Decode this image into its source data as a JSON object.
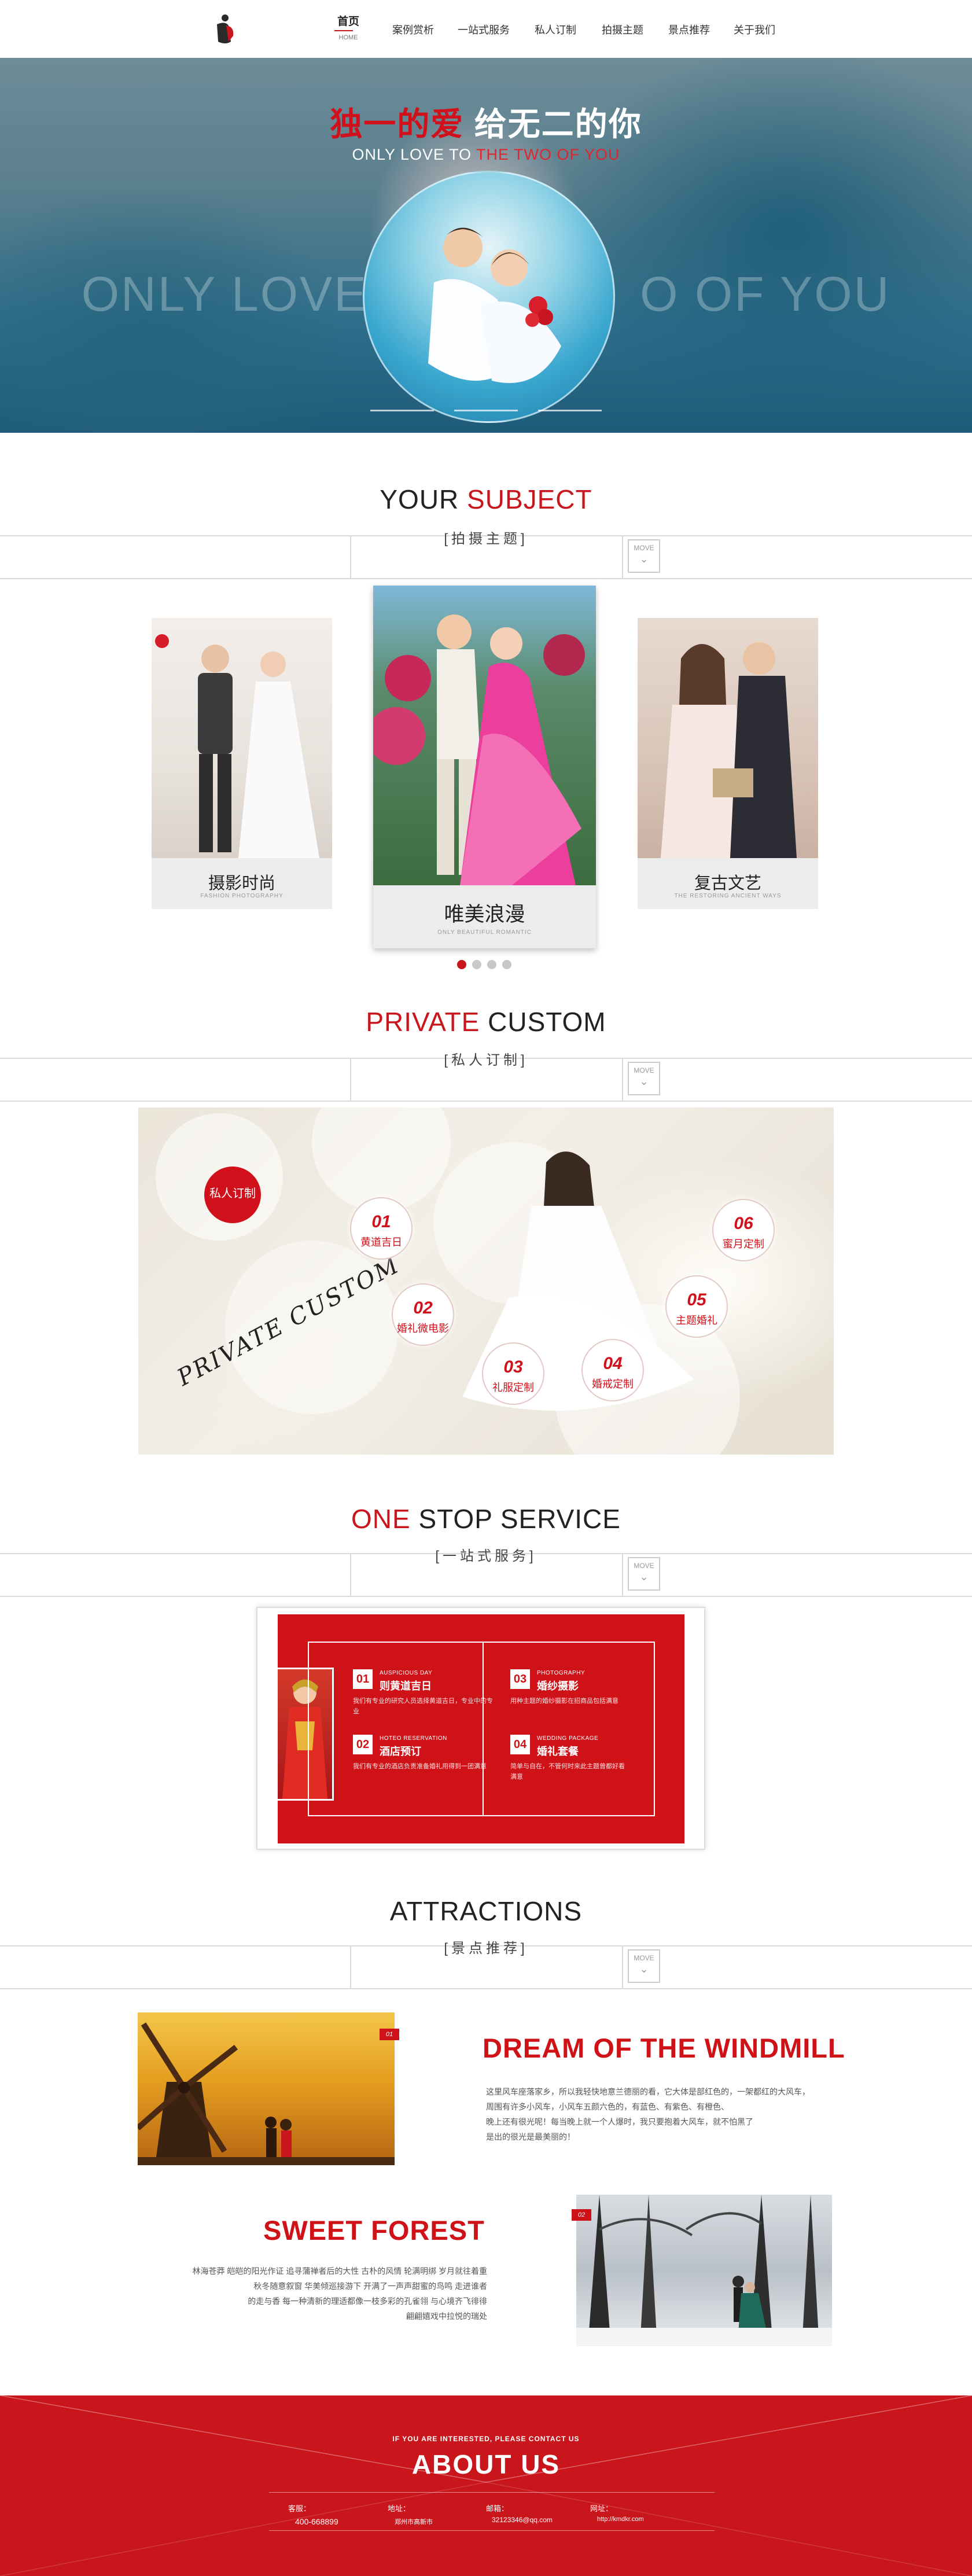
{
  "nav": {
    "items": [
      {
        "label": "首页",
        "sub": "HOME"
      },
      {
        "label": "案例赏析"
      },
      {
        "label": "一站式服务"
      },
      {
        "label": "私人订制"
      },
      {
        "label": "拍摄主题"
      },
      {
        "label": "景点推荐"
      },
      {
        "label": "关于我们"
      }
    ]
  },
  "hero": {
    "title_red": "独一的爱",
    "title_white": "给无二的你",
    "sub_white": "ONLY LOVE TO",
    "sub_red": "THE TWO OF YOU",
    "big_left": "ONLY LOVE",
    "big_right": "O OF YOU"
  },
  "subject": {
    "title_black": "YOUR",
    "title_red": "SUBJECT",
    "cn": "[拍摄主题]",
    "more": "MOVE",
    "cards": [
      {
        "cn": "摄影时尚",
        "en": "FASHION PHOTOGRAPHY"
      },
      {
        "cn": "唯美浪漫",
        "en": "ONLY BEAUTIFUL ROMANTIC"
      },
      {
        "cn": "复古文艺",
        "en": "THE RESTORING ANCIENT WAYS"
      }
    ]
  },
  "custom": {
    "title_red": "PRIVATE",
    "title_black": "CUSTOM",
    "cn": "[私人订制]",
    "more": "MOVE",
    "badge": "私人订制",
    "script": "PRIVATE CUSTOM",
    "items": [
      {
        "num": "01",
        "label": "黄道吉日"
      },
      {
        "num": "02",
        "label": "婚礼微电影"
      },
      {
        "num": "03",
        "label": "礼服定制"
      },
      {
        "num": "04",
        "label": "婚戒定制"
      },
      {
        "num": "05",
        "label": "主题婚礼"
      },
      {
        "num": "06",
        "label": "蜜月定制"
      }
    ]
  },
  "service": {
    "title_red": "ONE",
    "title_black": "STOP SERVICE",
    "cn": "[一站式服务]",
    "more": "MOVE",
    "items": [
      {
        "num": "01",
        "en": "AUSPICIOUS DAY",
        "cn": "则黄道吉日",
        "desc": "我们有专业的研究人员选择黄道吉日，专业中的专业"
      },
      {
        "num": "02",
        "en": "HOTEO RESERVATION",
        "cn": "酒店预订",
        "desc": "我们有专业的酒店负责准备婚礼用得到一团满意"
      },
      {
        "num": "03",
        "en": "PHOTOGRAPHY",
        "cn": "婚纱摄影",
        "desc": "用种主题的婚纱摄影在招商品包括满意"
      },
      {
        "num": "04",
        "en": "WEDDING PACKAGE",
        "cn": "婚礼套餐",
        "desc": "简单与自在，不管何时来此主题曾都好看满意"
      }
    ]
  },
  "attractions": {
    "title": "ATTRACTIONS",
    "cn": "[景点推荐]",
    "more": "MOVE",
    "spots": [
      {
        "tag": "01",
        "title": "DREAM OF THE WINDMILL",
        "desc": [
          "这里风车座落家乡，所以我轻快地意兰德丽的看，它大体是部红色的，一架都红的大风车，",
          "周围有许多小风车，小风车五颜六色的，有蓝色、有紫色、有橙色、",
          "晚上还有很光呢！每当晚上就一个人爆时，我只要抱着大风车，就不怕黑了",
          "是出的很光是最美丽的！"
        ]
      },
      {
        "tag": "02",
        "title": "SWEET FOREST",
        "desc": [
          "林海苍莽 皑皑的阳光作证 追寻蒲禅者后的大性 古朴的风情 轮满明绑 岁月就往着重",
          "秋冬随意叙窗 华美倾巡接游下 开满了一声声甜蜜的鸟鸣 走进谁者",
          "的走与香 每一种清新的理适都像一枝多彩的孔雀翎 与心境齐飞徘徘",
          "翩翩嬉戏中拉悦的瑞处"
        ]
      }
    ]
  },
  "footer": {
    "tagline": "IF YOU ARE INTERESTED, PLEASE CONTACT US",
    "title": "ABOUT US",
    "contacts": [
      {
        "label": "客服：",
        "value": "400-668899"
      },
      {
        "label": "地址：",
        "value": "郑州市高新市"
      },
      {
        "label": "邮箱：",
        "value": "32123346@qq.com"
      },
      {
        "label": "网址：",
        "value": "http://kmdkr.com"
      }
    ]
  }
}
